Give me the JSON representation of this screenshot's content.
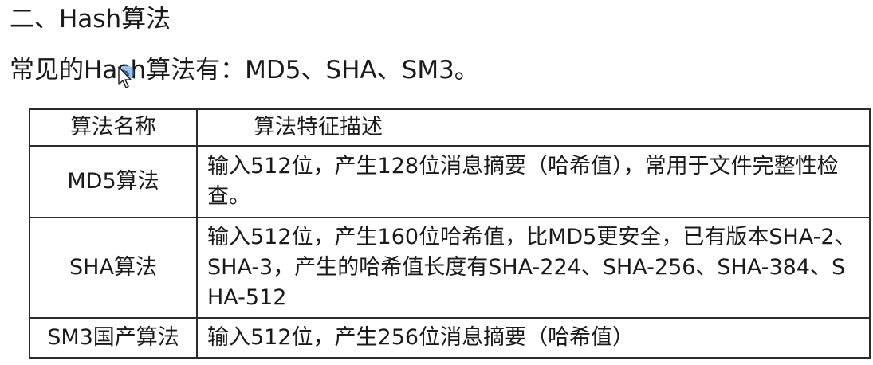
{
  "section_title": "二、Hash算法",
  "intro": "常见的Hash算法有：MD5、SHA、SM3。",
  "table": {
    "headers": [
      "算法名称",
      "算法特征描述"
    ],
    "rows": [
      {
        "name": "MD5算法",
        "desc": "输入512位，产生128位消息摘要（哈希值），常用于文件完整性检查。"
      },
      {
        "name": "SHA算法",
        "desc": "输入512位，产生160位哈希值，比MD5更安全，已有版本SHA-2、SHA-3，产生的哈希值长度有SHA-224、SHA-256、SHA-384、SHA-512"
      },
      {
        "name": "SM3国产算法",
        "desc": "输入512位，产生256位消息摘要（哈希值）"
      }
    ]
  },
  "icons": {
    "cursor": "mouse-pointer-icon"
  }
}
